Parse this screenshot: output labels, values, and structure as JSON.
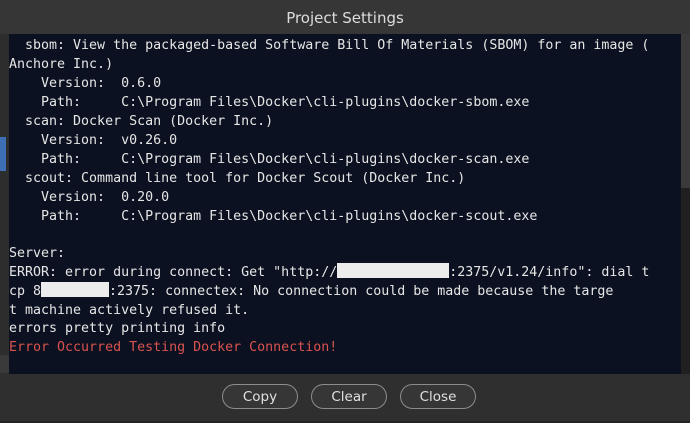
{
  "window": {
    "title": "Project Settings"
  },
  "console": {
    "lines": [
      "  sbom: View the packaged-based Software Bill Of Materials (SBOM) for an image (",
      "Anchore Inc.)",
      "    Version:  0.6.0",
      "    Path:     C:\\Program Files\\Docker\\cli-plugins\\docker-sbom.exe",
      "  scan: Docker Scan (Docker Inc.)",
      "    Version:  v0.26.0",
      "    Path:     C:\\Program Files\\Docker\\cli-plugins\\docker-scan.exe",
      "  scout: Command line tool for Docker Scout (Docker Inc.)",
      "    Version:  0.20.0",
      "    Path:     C:\\Program Files\\Docker\\cli-plugins\\docker-scout.exe",
      "",
      "Server:"
    ],
    "error_line1_prefix": "ERROR: error during connect: Get \"http://",
    "error_line1_suffix": ":2375/v1.24/info\": dial t",
    "error_line2_prefix": "cp 8",
    "error_line2_suffix": ":2375: connectex: No connection could be made because the targe",
    "error_line3": "t machine actively refused it.",
    "error_line4": "errors pretty printing info",
    "failure_message": "Error Occurred Testing Docker Connection!",
    "failure_color": "#d9534f"
  },
  "buttons": {
    "copy": "Copy",
    "clear": "Clear",
    "close": "Close"
  }
}
